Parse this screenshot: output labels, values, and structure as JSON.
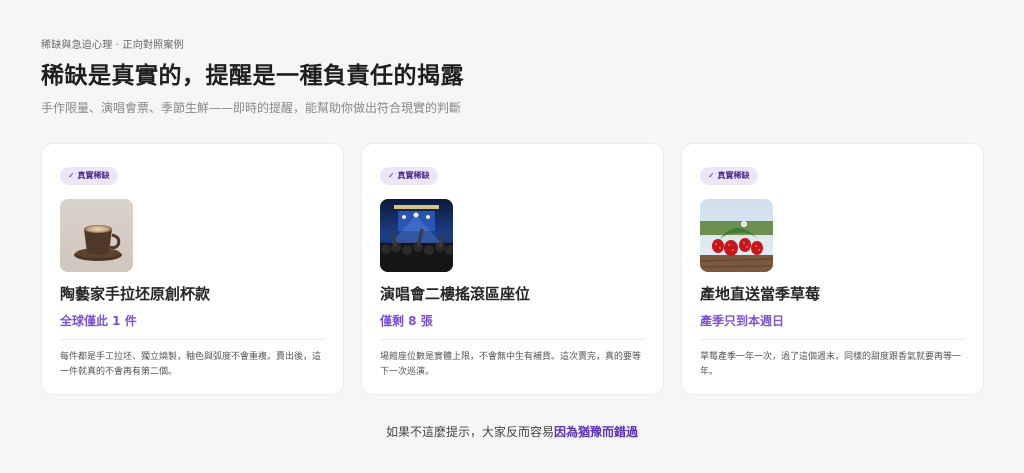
{
  "header": {
    "eyebrow": "稀缺與急迫心理 · 正向對照案例",
    "title": "稀缺是真實的，提醒是一種負責任的揭露",
    "subtitle": "手作限量、演唱會票、季節生鮮——即時的提醒，能幫助你做出符合現實的判斷"
  },
  "cards": [
    {
      "badge": "✓ 真實稀缺",
      "image_icon": "coffee-cup-photo",
      "title": "陶藝家手拉坯原創杯款",
      "highlight": "全球僅此 1 件",
      "description": "每件都是手工拉坯、獨立燒製，釉色與弧度不會重複。賣出後，這一件就真的不會再有第二個。"
    },
    {
      "badge": "✓ 真實稀缺",
      "image_icon": "concert-crowd-photo",
      "title": "演唱會二樓搖滾區座位",
      "highlight": "僅剩 8 張",
      "description": "場館座位數是實體上限，不會無中生有補貨。這次賣完，真的要等下一次巡演。"
    },
    {
      "badge": "✓ 真實稀缺",
      "image_icon": "strawberry-photo",
      "title": "產地直送當季草莓",
      "highlight": "產季只到本週日",
      "description": "草莓產季一年一次，過了這個週末，同樣的甜度跟香氣就要再等一年。"
    }
  ],
  "footer": {
    "prefix": "如果不這麼提示，大家反而容易",
    "emphasis": "因為猶豫而錯過"
  },
  "colors": {
    "accent": "#7a52d6",
    "badge_bg": "#ede6fb",
    "footer_emphasis": "#5a32b5"
  }
}
